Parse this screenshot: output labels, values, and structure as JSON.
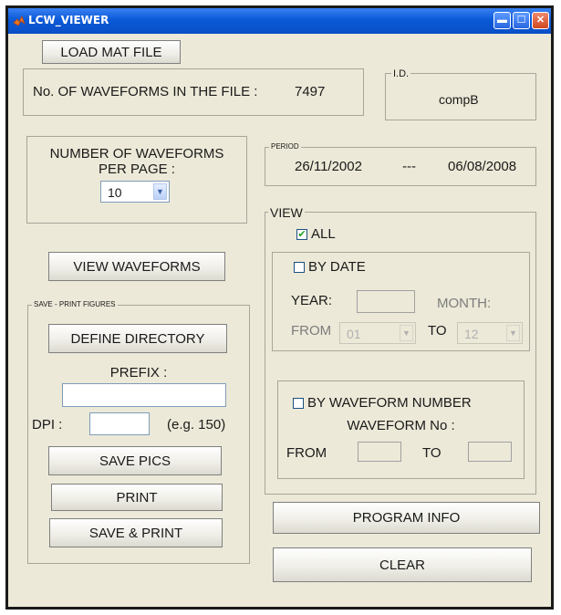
{
  "window": {
    "title": "LCW_VIEWER"
  },
  "load": {
    "button_label": "LOAD MAT FILE",
    "count_label": "No. OF WAVEFORMS IN THE FILE :",
    "count_value": "7497"
  },
  "id": {
    "title": "I.D.",
    "value": "compB"
  },
  "per_page": {
    "label_line1": "NUMBER OF WAVEFORMS",
    "label_line2": "PER PAGE :",
    "selected": "10"
  },
  "period": {
    "title": "PERIOD",
    "start": "26/11/2002",
    "separator": "---",
    "end": "06/08/2008"
  },
  "view_waveforms_button": "VIEW WAVEFORMS",
  "save_print": {
    "title": "SAVE - PRINT FIGURES",
    "define_directory": "DEFINE DIRECTORY",
    "prefix_label": "PREFIX :",
    "prefix_value": "",
    "dpi_label": "DPI :",
    "dpi_value": "",
    "dpi_hint": "(e.g. 150)",
    "save_pics": "SAVE PICS",
    "print": "PRINT",
    "save_and_print": "SAVE & PRINT"
  },
  "view": {
    "title": "VIEW",
    "all_label": "ALL",
    "all_checked": true,
    "by_date": {
      "label": "BY DATE",
      "checked": false,
      "year_label": "YEAR:",
      "year_value": "",
      "month_label": "MONTH:",
      "from_label": "FROM",
      "from_value": "01",
      "to_label": "TO",
      "to_value": "12"
    },
    "by_number": {
      "label": "BY WAVEFORM NUMBER",
      "checked": false,
      "waveform_no_label": "WAVEFORM No :",
      "from_label": "FROM",
      "from_value": "",
      "to_label": "TO",
      "to_value": ""
    }
  },
  "program_info_button": "PROGRAM INFO",
  "clear_button": "CLEAR",
  "colors": {
    "titlebar": "#0a5ad8",
    "client_bg": "#ece9d8",
    "check_mark": "#21a121"
  }
}
